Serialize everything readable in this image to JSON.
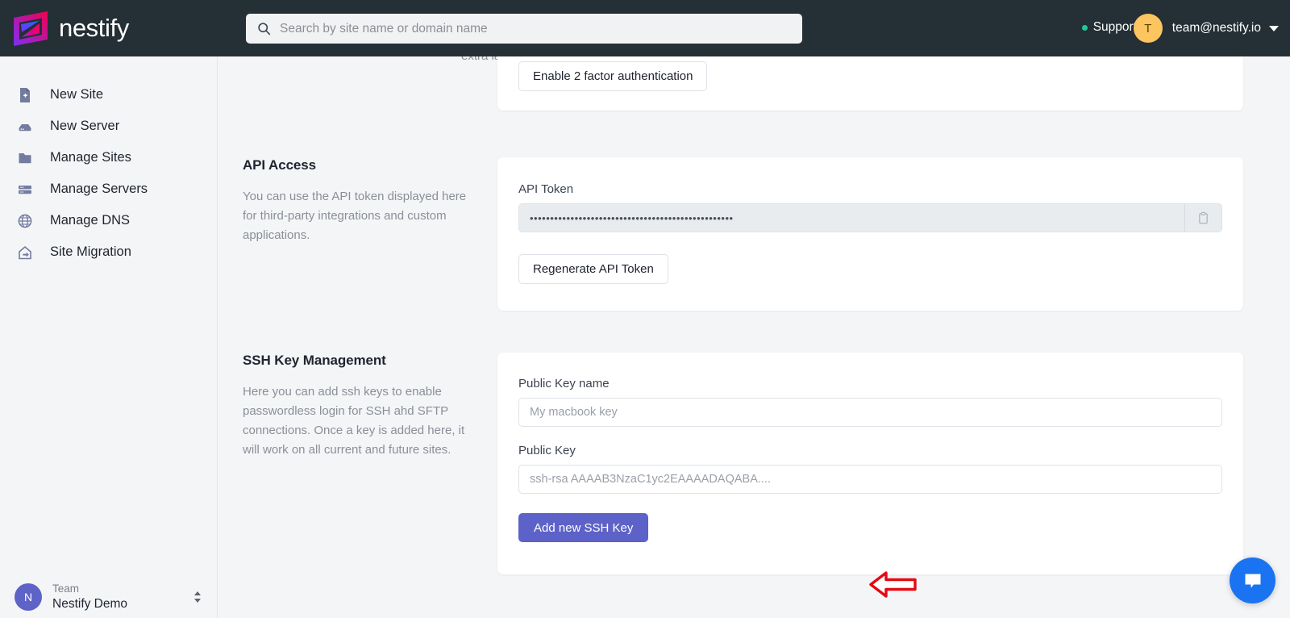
{
  "topbar": {
    "brand_name": "nestify",
    "logo_icon": "nestify-logo-icon",
    "search": {
      "icon": "search-icon",
      "placeholder": "Search by site name or domain name",
      "value": ""
    },
    "support_label": "Support",
    "support_status_color": "#20c997",
    "account": {
      "avatar_initial": "T",
      "avatar_color": "#fcc55f",
      "email": "team@nestify.io",
      "caret_icon": "chevron-down-icon"
    }
  },
  "sidebar": {
    "items": [
      {
        "label": "New Site",
        "icon": "file-plus-icon"
      },
      {
        "label": "New Server",
        "icon": "server-add-icon"
      },
      {
        "label": "Manage Sites",
        "icon": "folder-icon"
      },
      {
        "label": "Manage Servers",
        "icon": "servers-icon"
      },
      {
        "label": "Manage DNS",
        "icon": "globe-icon"
      },
      {
        "label": "Site Migration",
        "icon": "migration-icon"
      }
    ],
    "footer": {
      "avatar_initial": "N",
      "avatar_color": "#5e63c8",
      "team_label": "Team",
      "team_name": "Nestify Demo",
      "switch_icon": "up-down-chevrons-icon"
    }
  },
  "main": {
    "clipped_text": "extra layer of security to your account.",
    "two_factor": {
      "button_label": "Enable 2 factor authentication"
    },
    "api_access": {
      "title": "API Access",
      "description": "You can use the API token displayed here for third-party integrations and custom applications.",
      "token_label": "API Token",
      "token_value": "••••••••••••••••••••••••••••••••••••••••••••••••••",
      "copy_icon": "clipboard-copy-icon",
      "regenerate_label": "Regenerate API Token"
    },
    "ssh": {
      "title": "SSH Key Management",
      "description": "Here you can add ssh keys to enable passwordless login for SSH ahd SFTP connections. Once a key is added here, it will work on all current and future sites.",
      "key_name_label": "Public Key name",
      "key_name_placeholder": "My macbook key",
      "key_name_value": "",
      "public_key_label": "Public Key",
      "public_key_placeholder": "ssh-rsa AAAAB3NzaC1yc2EAAAADAQABA....",
      "public_key_value": "",
      "add_button_label": "Add new SSH Key",
      "add_button_color": "#5c62c8",
      "annotation_icon": "red-left-arrow-annotation"
    }
  },
  "chat_widget": {
    "icon": "chat-bubble-icon",
    "color": "#1a73f0"
  }
}
